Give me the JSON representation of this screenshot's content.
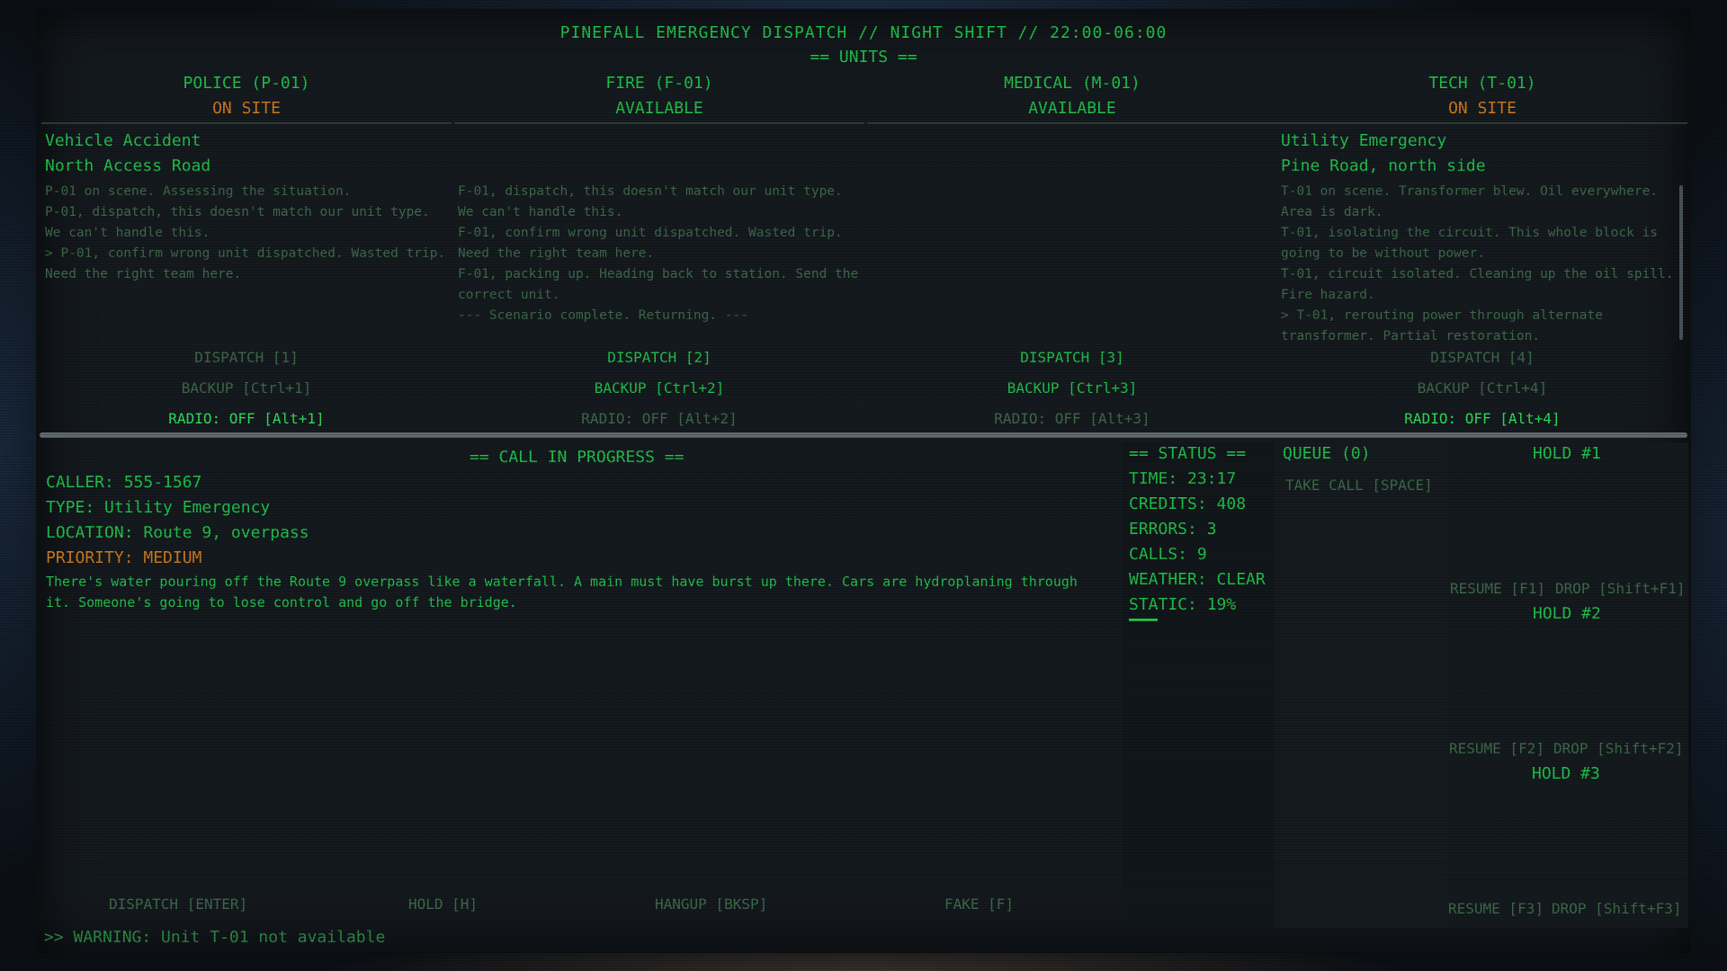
{
  "header": {
    "title": "PINEFALL EMERGENCY DISPATCH // NIGHT SHIFT // 22:00-06:00",
    "units_heading": "== UNITS =="
  },
  "units": [
    {
      "name": "POLICE (P-01)",
      "status": "ON SITE",
      "incident_type": "Vehicle Accident",
      "incident_location": "North Access Road",
      "log": [
        "  P-01 on scene. Assessing the situation.",
        "  P-01, dispatch, this doesn't match our unit type. We can't handle this.",
        "> P-01, confirm wrong unit dispatched. Wasted trip. Need the right team here."
      ],
      "dispatch": "DISPATCH [1]",
      "backup": "BACKUP [Ctrl+1]",
      "radio": "RADIO: OFF [Alt+1]"
    },
    {
      "name": "FIRE (F-01)",
      "status": "AVAILABLE",
      "incident_type": "",
      "incident_location": "",
      "log": [
        "  F-01, dispatch, this doesn't match our unit type. We can't handle this.",
        "  F-01, confirm wrong unit dispatched. Wasted trip. Need the right team here.",
        "  F-01, packing up. Heading back to station. Send the correct unit.",
        "  --- Scenario complete. Returning. ---"
      ],
      "dispatch": "DISPATCH [2]",
      "backup": "BACKUP [Ctrl+2]",
      "radio": "RADIO: OFF [Alt+2]"
    },
    {
      "name": "MEDICAL (M-01)",
      "status": "AVAILABLE",
      "incident_type": "",
      "incident_location": "",
      "log": [],
      "dispatch": "DISPATCH [3]",
      "backup": "BACKUP [Ctrl+3]",
      "radio": "RADIO: OFF [Alt+3]"
    },
    {
      "name": "TECH (T-01)",
      "status": "ON SITE",
      "incident_type": "Utility Emergency",
      "incident_location": "Pine Road, north side",
      "log": [
        "  T-01 on scene. Transformer blew. Oil everywhere. Area is dark.",
        "  T-01, isolating the circuit. This whole block is going to be without power.",
        "  T-01, circuit isolated. Cleaning up the oil spill. Fire hazard.",
        "> T-01, rerouting power through alternate transformer. Partial restoration."
      ],
      "dispatch": "DISPATCH [4]",
      "backup": "BACKUP [Ctrl+4]",
      "radio": "RADIO: OFF [Alt+4]"
    }
  ],
  "call": {
    "heading": "== CALL IN PROGRESS ==",
    "caller": "CALLER: 555-1567",
    "type": "TYPE: Utility Emergency",
    "location": "LOCATION: Route 9, overpass",
    "priority": "PRIORITY: MEDIUM",
    "description": "There's water pouring off the Route 9 overpass like a waterfall. A main must have burst up there. Cars are hydroplaning through it. Someone's going to lose control and go off the bridge."
  },
  "status": {
    "heading": "== STATUS ==",
    "time": "TIME: 23:17",
    "credits": "CREDITS: 408",
    "errors": "ERRORS: 3",
    "calls": "CALLS: 9",
    "weather": "WEATHER: CLEAR",
    "static": "STATIC: 19%",
    "static_level": 0.19
  },
  "queue": {
    "heading": "QUEUE (0)",
    "take_call": "TAKE CALL [SPACE]"
  },
  "holds": [
    {
      "label": "HOLD #1",
      "resume": "RESUME [F1]",
      "drop": "DROP [Shift+F1]"
    },
    {
      "label": "HOLD #2",
      "resume": "RESUME [F2]",
      "drop": "DROP [Shift+F2]"
    },
    {
      "label": "HOLD #3",
      "resume": "RESUME [F3]",
      "drop": "DROP [Shift+F3]"
    }
  ],
  "actions": {
    "dispatch": "DISPATCH [ENTER]",
    "hold": "HOLD [H]",
    "hangup": "HANGUP [BKSP]",
    "fake": "FAKE [F]"
  },
  "warning": ">> WARNING: Unit T-01 not available",
  "colors": {
    "green": "#21c24a",
    "dim_green": "#3e6b4a",
    "orange": "#d07a1c",
    "background": "#151a1f"
  }
}
